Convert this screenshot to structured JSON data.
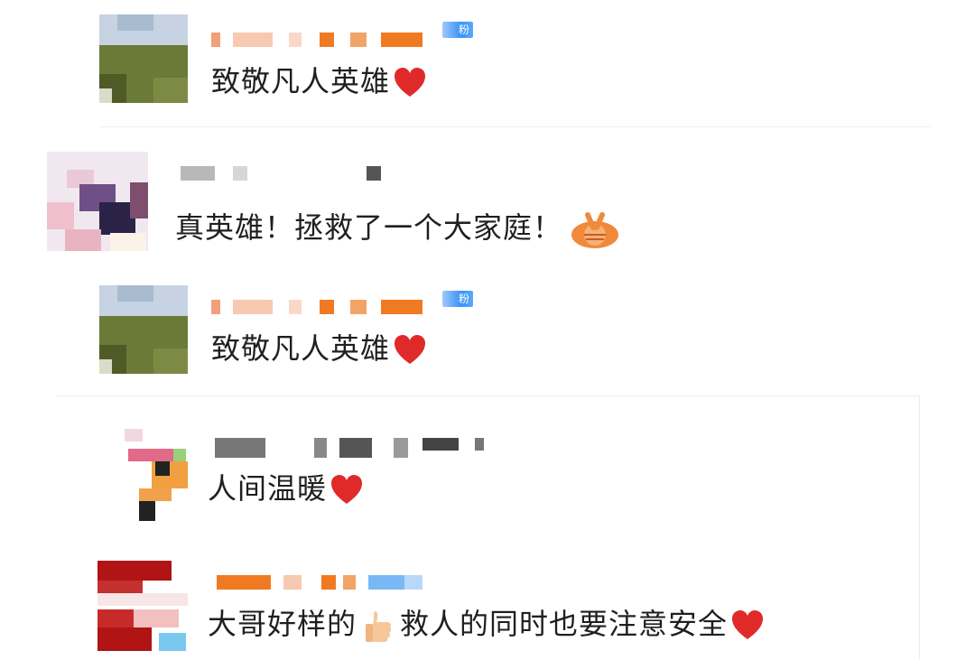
{
  "colors": {
    "heart": "#e02a2a",
    "fan_badge": "#3a93f5",
    "name_mosaic": "#f07a22",
    "text": "#1f1f1f"
  },
  "comments": [
    {
      "text": "致敬凡人英雄",
      "emoji": "heart-icon",
      "badge": "粉",
      "avatar": "pixelated-avatar"
    },
    {
      "text": "真英雄！拯救了一个大家庭！",
      "emoji": "fist-emoji-icon",
      "avatar": "pixelated-avatar"
    },
    {
      "text": "致敬凡人英雄",
      "emoji": "heart-icon",
      "badge": "粉",
      "avatar": "pixelated-avatar"
    }
  ],
  "replies": [
    {
      "text": "人间温暖",
      "emoji": "heart-icon",
      "avatar": "pixelated-avatar"
    },
    {
      "text_a": "大哥好样的",
      "emoji_a": "thumbs-up-icon",
      "text_b": "救人的同时也要注意安全",
      "emoji_b": "heart-icon",
      "avatar": "pixelated-avatar"
    }
  ]
}
